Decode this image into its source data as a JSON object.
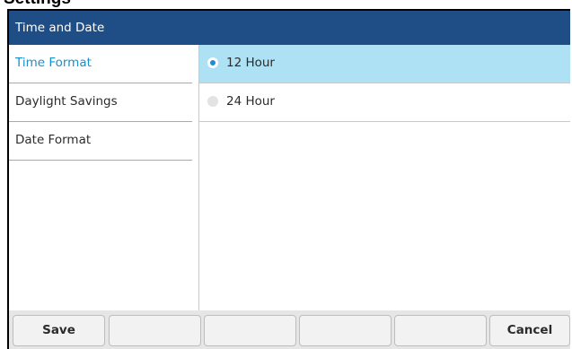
{
  "page_heading": "Settings",
  "window": {
    "title": "Time and Date"
  },
  "sidebar": {
    "items": [
      {
        "label": "Time Format",
        "active": true
      },
      {
        "label": "Daylight Savings",
        "active": false
      },
      {
        "label": "Date Format",
        "active": false
      }
    ]
  },
  "content": {
    "options": [
      {
        "label": "12 Hour",
        "selected": true
      },
      {
        "label": "24 Hour",
        "selected": false
      }
    ]
  },
  "softkeys": [
    "Save",
    "",
    "",
    "",
    "",
    "Cancel"
  ],
  "colors": {
    "titlebar": "#1f4e87",
    "accent": "#1a8fc9",
    "selected_row": "#aee1f4",
    "softkey_bar": "#e6e6e6"
  }
}
